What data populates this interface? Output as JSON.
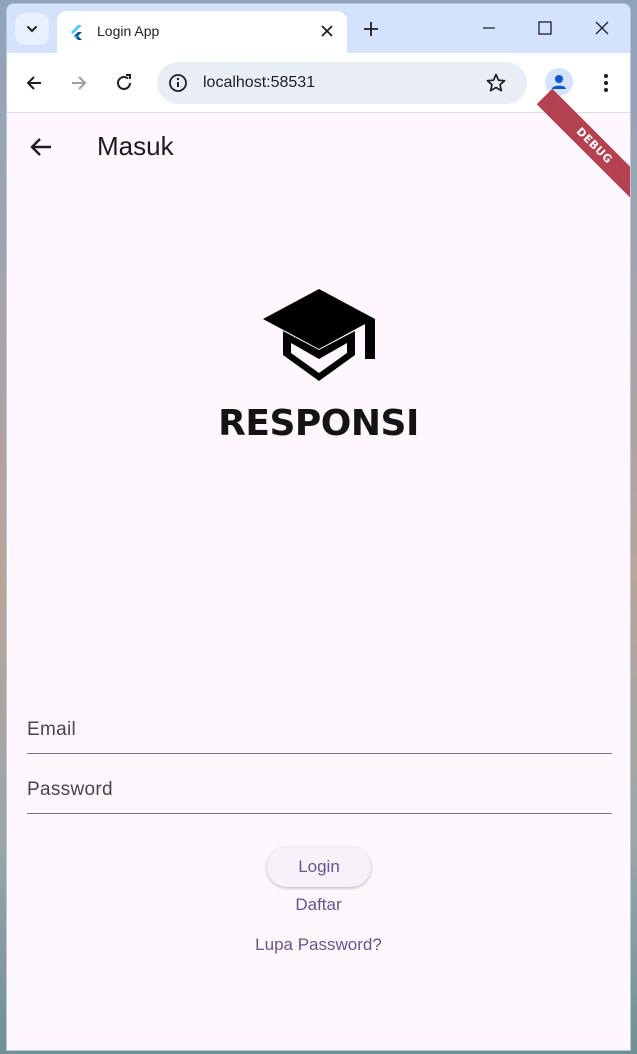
{
  "browser": {
    "tab_title": "Login App",
    "url": "localhost:58531"
  },
  "app": {
    "appbar_title": "Masuk",
    "debug_label": "DEBUG",
    "logo_text": "RESPONSI",
    "email_label": "Email",
    "password_label": "Password",
    "login_label": "Login",
    "register_label": "Daftar",
    "forgot_label": "Lupa Password?"
  },
  "colors": {
    "background": "#fef7fd",
    "accent": "#65558f",
    "ribbon": "#b4414f"
  },
  "icons": {
    "logo": "school-icon",
    "back": "arrow-back-icon"
  }
}
